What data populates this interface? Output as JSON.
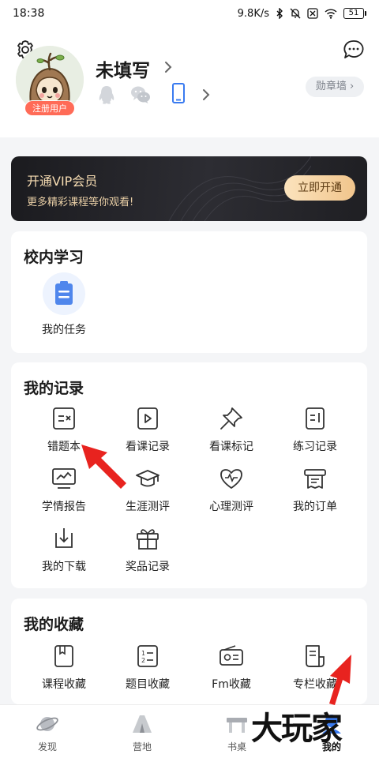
{
  "status_bar": {
    "time": "18:38",
    "net_speed": "9.8K/s",
    "battery": "51"
  },
  "header": {
    "settings_icon": "gear-icon",
    "message_icon": "chat-bubble-icon",
    "username": "未填写",
    "user_badge": "注册用户",
    "social": [
      "qq-icon",
      "wechat-icon",
      "phone-icon"
    ],
    "medal_wall": "勋章墙"
  },
  "vip": {
    "title": "开通VIP会员",
    "subtitle": "更多精彩课程等你观看!",
    "button": "立即开通",
    "colors": {
      "background": "#1b1b1f",
      "title": "#f6dcb2",
      "button": "#f1c58c"
    }
  },
  "school": {
    "title": "校内学习",
    "items": [
      {
        "label": "我的任务",
        "icon": "clipboard-icon"
      }
    ]
  },
  "records": {
    "title": "我的记录",
    "items": [
      {
        "label": "错题本",
        "icon": "wrong-answers-icon"
      },
      {
        "label": "看课记录",
        "icon": "video-play-icon"
      },
      {
        "label": "看课标记",
        "icon": "pushpin-icon"
      },
      {
        "label": "练习记录",
        "icon": "practice-icon"
      },
      {
        "label": "学情报告",
        "icon": "monitor-chart-icon"
      },
      {
        "label": "生涯测评",
        "icon": "graduation-cap-icon"
      },
      {
        "label": "心理测评",
        "icon": "heart-pulse-icon"
      },
      {
        "label": "我的订单",
        "icon": "receipt-icon"
      },
      {
        "label": "我的下载",
        "icon": "download-icon"
      },
      {
        "label": "奖品记录",
        "icon": "gift-icon"
      }
    ]
  },
  "favorites": {
    "title": "我的收藏",
    "items": [
      {
        "label": "课程收藏",
        "icon": "bookmark-book-icon"
      },
      {
        "label": "题目收藏",
        "icon": "numbered-list-icon"
      },
      {
        "label": "Fm收藏",
        "icon": "radio-icon"
      },
      {
        "label": "专栏收藏",
        "icon": "document-icon"
      }
    ]
  },
  "tabbar": {
    "tabs": [
      {
        "label": "发现",
        "icon": "planet-icon"
      },
      {
        "label": "营地",
        "icon": "tent-icon"
      },
      {
        "label": "书桌",
        "icon": "desk-icon"
      },
      {
        "label": "我的",
        "icon": "profile-icon",
        "active": true
      }
    ]
  },
  "watermark": "大玩家",
  "accent_color": "#3a7bf0",
  "annotation_color": "#e8231f"
}
